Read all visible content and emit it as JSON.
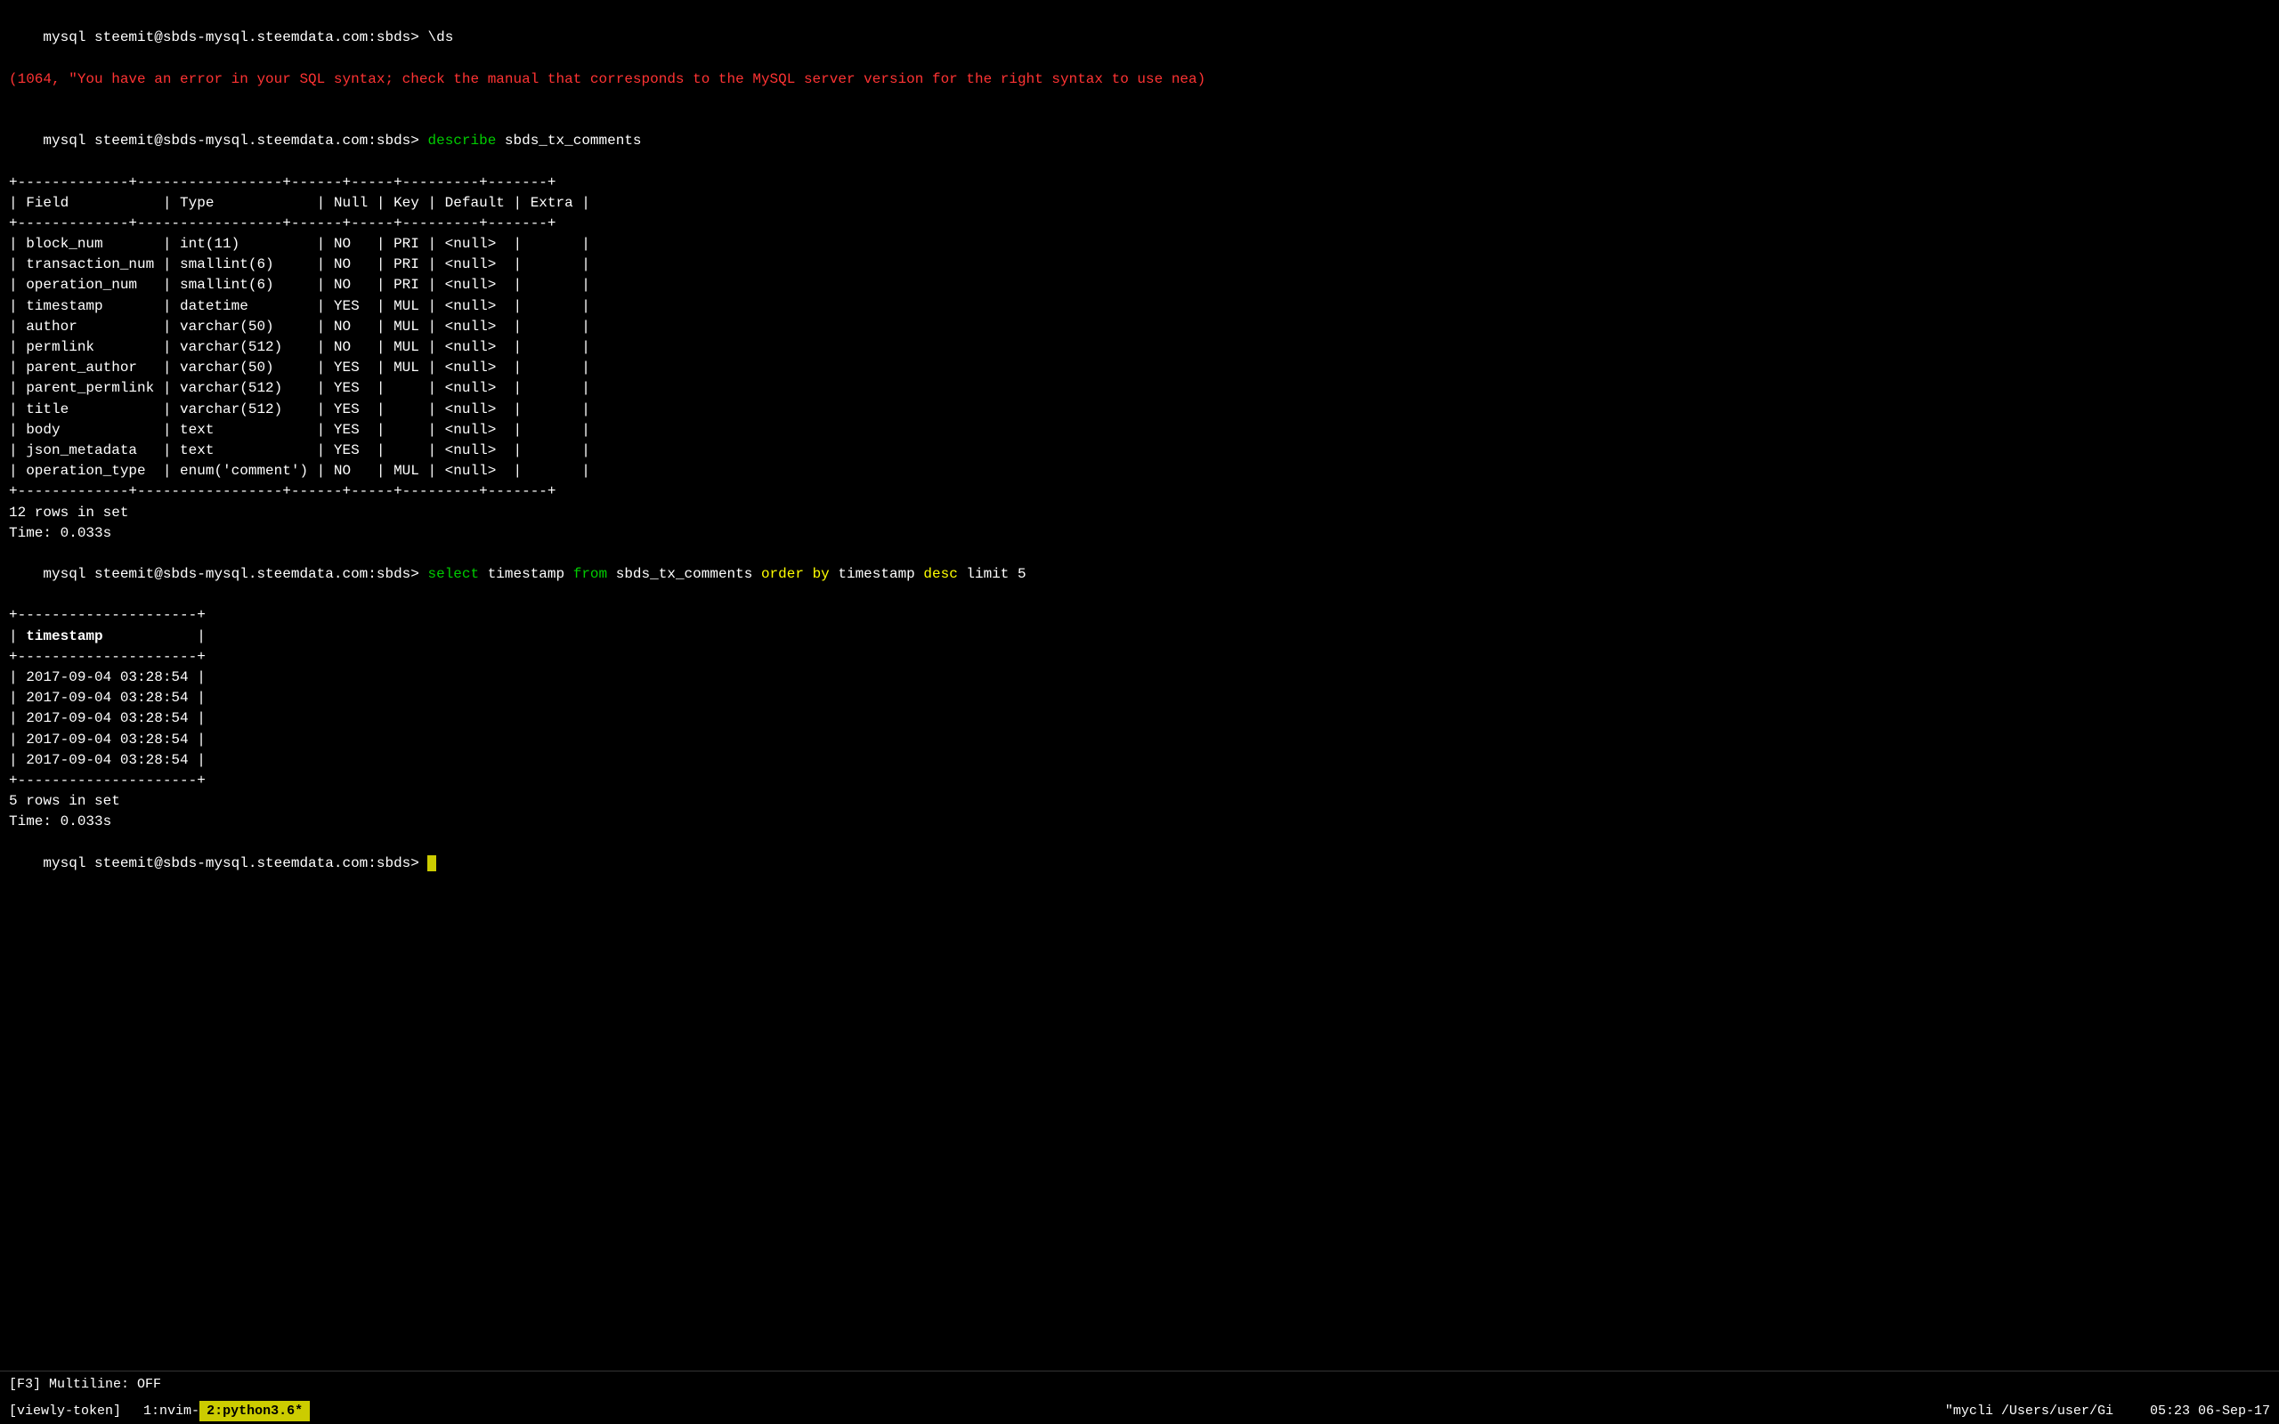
{
  "terminal": {
    "lines": [
      {
        "type": "prompt_cmd",
        "prompt": "mysql steemit@sbds-mysql.steemdata.com:sbds> ",
        "command": "\\ds"
      },
      {
        "type": "error",
        "text": "(1064, \"You have an error in your SQL syntax; check the manual that corresponds to the MySQL server version for the right syntax to use nea)"
      },
      {
        "type": "blank"
      },
      {
        "type": "prompt_cmd_colored",
        "prompt": "mysql steemit@sbds-mysql.steemdata.com:sbds> ",
        "keyword": "describe",
        "rest": " sbds_tx_comments"
      },
      {
        "type": "table_line",
        "text": "+-------------+-----------------+------+-----+---------+-------+"
      },
      {
        "type": "table_line",
        "text": "| Field       | Type            | Null | Key | Default | Extra |"
      },
      {
        "type": "table_line",
        "text": "+-------------+-----------------+------+-----+---------+-------+"
      },
      {
        "type": "table_line",
        "text": "| block_num       | int(11)         | NO   | PRI | <null>  |       |"
      },
      {
        "type": "table_line",
        "text": "| transaction_num | smallint(6)     | NO   | PRI | <null>  |       |"
      },
      {
        "type": "table_line",
        "text": "| operation_num   | smallint(6)     | NO   | PRI | <null>  |       |"
      },
      {
        "type": "table_line",
        "text": "| timestamp       | datetime        | YES  | MUL | <null>  |       |"
      },
      {
        "type": "table_line",
        "text": "| author          | varchar(50)     | NO   | MUL | <null>  |       |"
      },
      {
        "type": "table_line",
        "text": "| permlink        | varchar(512)    | NO   | MUL | <null>  |       |"
      },
      {
        "type": "table_line",
        "text": "| parent_author   | varchar(50)     | YES  | MUL | <null>  |       |"
      },
      {
        "type": "table_line",
        "text": "| parent_permlink | varchar(512)    | YES  |     | <null>  |       |"
      },
      {
        "type": "table_line",
        "text": "| title           | varchar(512)    | YES  |     | <null>  |       |"
      },
      {
        "type": "table_line",
        "text": "| body            | text            | YES  |     | <null>  |       |"
      },
      {
        "type": "table_line",
        "text": "| json_metadata   | text            | YES  |     | <null>  |       |"
      },
      {
        "type": "table_line",
        "text": "| operation_type  | enum('comment') | NO   | MUL | <null>  |       |"
      },
      {
        "type": "table_line",
        "text": "+-------------+-----------------+------+-----+---------+-------+"
      },
      {
        "type": "plain",
        "text": "12 rows in set"
      },
      {
        "type": "plain",
        "text": "Time: 0.033s"
      },
      {
        "type": "prompt_select",
        "prompt": "mysql steemit@sbds-mysql.steemdata.com:sbds> ",
        "select": "select",
        "mid": " timestamp from ",
        "table": "sbds_tx_comments",
        "order": " order by timestamp desc limit 5"
      },
      {
        "type": "table_line2",
        "text": "+----------------------+"
      },
      {
        "type": "table_line2",
        "text": "| timestamp            |"
      },
      {
        "type": "table_line2",
        "text": "+----------------------+"
      },
      {
        "type": "table_line2",
        "text": "| 2017-09-04 03:28:54 |"
      },
      {
        "type": "table_line2",
        "text": "| 2017-09-04 03:28:54 |"
      },
      {
        "type": "table_line2",
        "text": "| 2017-09-04 03:28:54 |"
      },
      {
        "type": "table_line2",
        "text": "| 2017-09-04 03:28:54 |"
      },
      {
        "type": "table_line2",
        "text": "| 2017-09-04 03:28:54 |"
      },
      {
        "type": "table_line2",
        "text": "+----------------------+"
      },
      {
        "type": "plain",
        "text": "5 rows in set"
      },
      {
        "type": "plain",
        "text": "Time: 0.033s"
      },
      {
        "type": "prompt_cursor",
        "prompt": "mysql steemit@sbds-mysql.steemdata.com:sbds> "
      }
    ]
  },
  "statusbar": {
    "f3_label": "[F3] Multiline: OFF",
    "vim_mode": "[viewly-token]",
    "tab1": "1:nvim-",
    "tab2": "2:python3.6*",
    "right_app": "\"mycli",
    "right_path": "/Users/user/Gi",
    "right_time": "05:23 06-Sep-17"
  }
}
